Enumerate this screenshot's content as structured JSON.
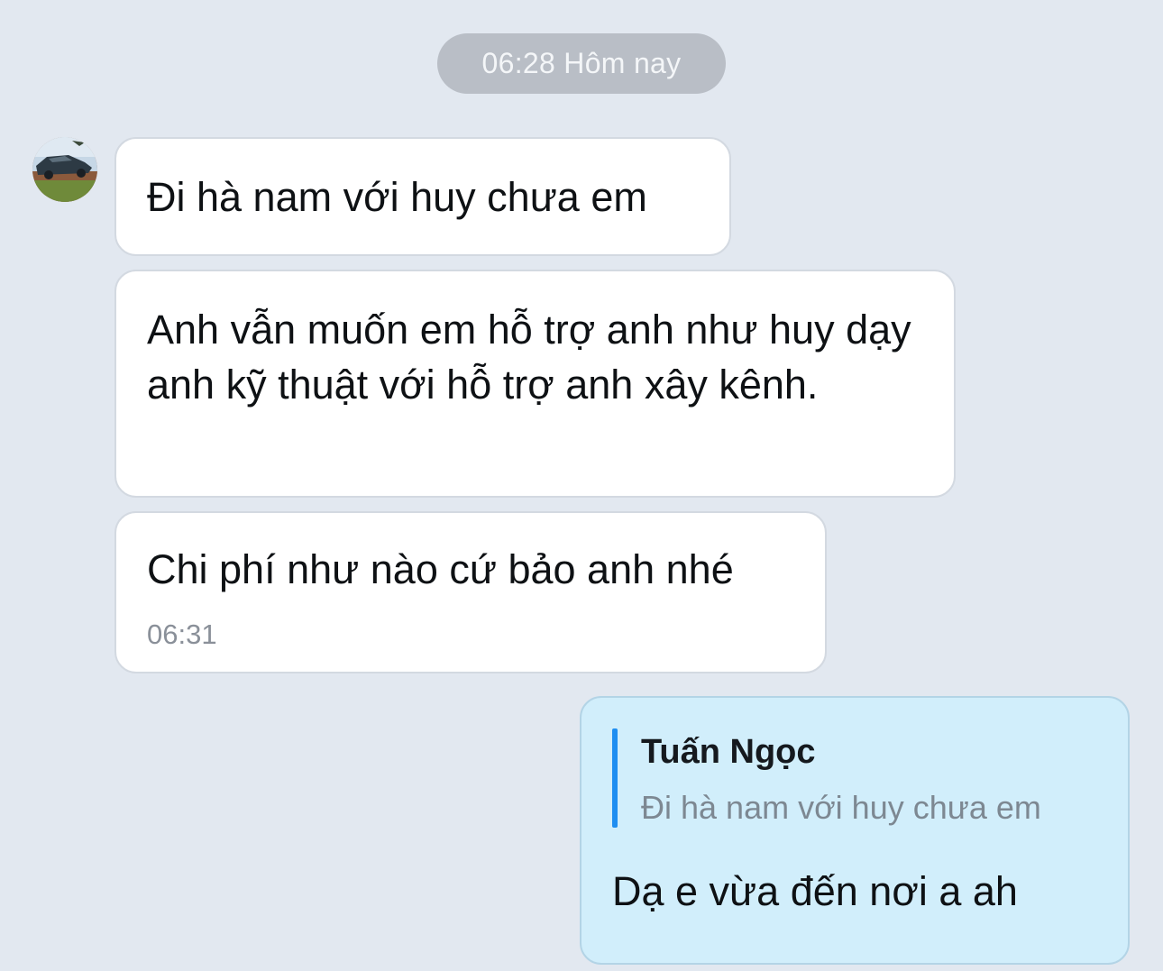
{
  "chat": {
    "date_separator": "06:28 Hôm nay",
    "messages": [
      {
        "text": "Đi hà nam với huy chưa em"
      },
      {
        "text": "Anh vẫn muốn em hỗ trợ anh như huy dạy anh kỹ thuật với hỗ trợ anh xây kênh."
      },
      {
        "text": "Chi phí như nào cứ bảo anh nhé",
        "time": "06:31"
      }
    ],
    "reply": {
      "quote_author": "Tuấn Ngọc",
      "quote_text": "Đi hà nam với huy chưa em",
      "text": "Dạ e vừa đến nơi a ah"
    }
  },
  "colors": {
    "background": "#e2e8f0",
    "incoming_bubble": "#ffffff",
    "outgoing_bubble": "#d1eefb",
    "quote_bar": "#1f8ef1",
    "time_pill": "#b9bec6"
  },
  "icons": {
    "sender_avatar": "avatar-photo"
  }
}
